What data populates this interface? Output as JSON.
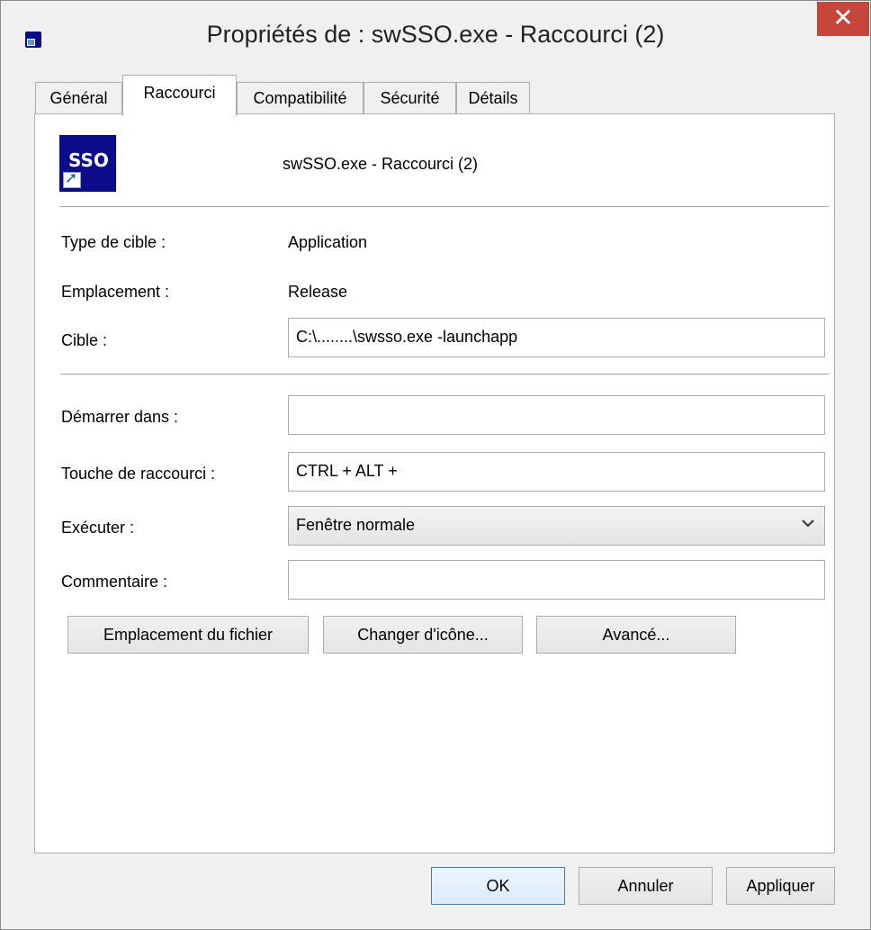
{
  "window": {
    "title": "Propriétés de : swSSO.exe - Raccourci (2)",
    "app_icon": "shortcut-app-icon",
    "close_glyph": "✕"
  },
  "tabs": [
    {
      "label": "Général",
      "active": false
    },
    {
      "label": "Raccourci",
      "active": true
    },
    {
      "label": "Compatibilité",
      "active": false
    },
    {
      "label": "Sécurité",
      "active": false
    },
    {
      "label": "Détails",
      "active": false
    }
  ],
  "shortcut": {
    "icon_text": "SSO",
    "name": "swSSO.exe - Raccourci (2)",
    "target_type_label": "Type de cible :",
    "target_type_value": "Application",
    "location_label": "Emplacement :",
    "location_value": "Release",
    "target_label": "Cible :",
    "target_value": "C:\\........\\swsso.exe -launchapp",
    "start_in_label": "Démarrer dans :",
    "start_in_value": "",
    "hotkey_label": "Touche de raccourci :",
    "hotkey_value": "CTRL + ALT +",
    "run_label": "Exécuter :",
    "run_value": "Fenêtre normale",
    "comment_label": "Commentaire :",
    "comment_value": ""
  },
  "panel_buttons": {
    "open_location": "Emplacement du fichier",
    "change_icon": "Changer d'icône...",
    "advanced": "Avancé..."
  },
  "dialog_buttons": {
    "ok": "OK",
    "cancel": "Annuler",
    "apply": "Appliquer"
  },
  "colors": {
    "close_button": "#c7463c",
    "icon_background": "#0c0c8a",
    "default_button_border": "#3c7fb1"
  }
}
